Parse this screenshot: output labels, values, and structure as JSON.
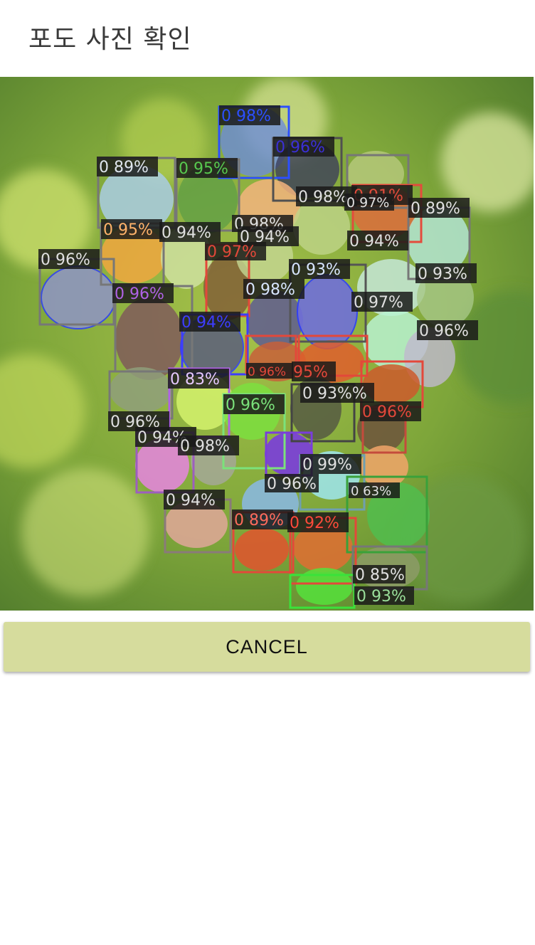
{
  "app": {
    "title": "포도 사진 확인"
  },
  "photo": {
    "detections": [
      {
        "label": "0 98%",
        "color": "#2c4fff"
      },
      {
        "label": "0 96%",
        "color": "#3b2fd6"
      },
      {
        "label": "0 89%",
        "color": "#dfe6ee"
      },
      {
        "label": "0 95%",
        "color": "#57c94f"
      },
      {
        "label": "0 98%",
        "color": "#e0e0e0"
      },
      {
        "label": "0 91%",
        "color": "#e44b3c"
      },
      {
        "label": "0 97%",
        "color": "#e0e0e0"
      },
      {
        "label": "0 89%",
        "color": "#e0e0e0"
      },
      {
        "label": "0 95%",
        "color": "#ffb36b"
      },
      {
        "label": "0 94%",
        "color": "#e0e0e0"
      },
      {
        "label": "0 98%",
        "color": "#e0e0e0"
      },
      {
        "label": "0 94%",
        "color": "#e0e0e0"
      },
      {
        "label": "0 97%",
        "color": "#e3483a"
      },
      {
        "label": "0 94%",
        "color": "#e0e0e0"
      },
      {
        "label": "0 96%",
        "color": "#e0e0e0"
      },
      {
        "label": "0 93%",
        "color": "#d8e6ff"
      },
      {
        "label": "0 93%",
        "color": "#e0e0e0"
      },
      {
        "label": "0 96%",
        "color": "#b062e6"
      },
      {
        "label": "0 98%",
        "color": "#d8e6ff"
      },
      {
        "label": "0 97%",
        "color": "#e0e0e0"
      },
      {
        "label": "0 94%",
        "color": "#3d3dff"
      },
      {
        "label": "0 96%",
        "color": "#e0e0e0"
      },
      {
        "label": "0 83%",
        "color": "#e6c8ff"
      },
      {
        "label": "0 96%",
        "color": "#e3483a"
      },
      {
        "label": "95%",
        "color": "#e3483a"
      },
      {
        "label": "0 93%%",
        "color": "#e0e0e0"
      },
      {
        "label": "0 96%",
        "color": "#7be27b"
      },
      {
        "label": "0 96%",
        "color": "#e3483a"
      },
      {
        "label": "0 96%",
        "color": "#e0e0e0"
      },
      {
        "label": "0 94%",
        "color": "#e0e0e0"
      },
      {
        "label": "0 98%",
        "color": "#e0e0e0"
      },
      {
        "label": "0 99%",
        "color": "#e0e0e0"
      },
      {
        "label": "0 96%",
        "color": "#e0e0e0"
      },
      {
        "label": "0 63%",
        "color": "#e0e0e0"
      },
      {
        "label": "0 94%",
        "color": "#e0e0e0"
      },
      {
        "label": "0 89%",
        "color": "#ff6b5c"
      },
      {
        "label": "0 92%",
        "color": "#ff4a3a"
      },
      {
        "label": "0 85%",
        "color": "#e0e0e0"
      },
      {
        "label": "0 93%",
        "color": "#9adf9a"
      }
    ]
  },
  "actions": {
    "cancel_label": "CANCEL"
  }
}
